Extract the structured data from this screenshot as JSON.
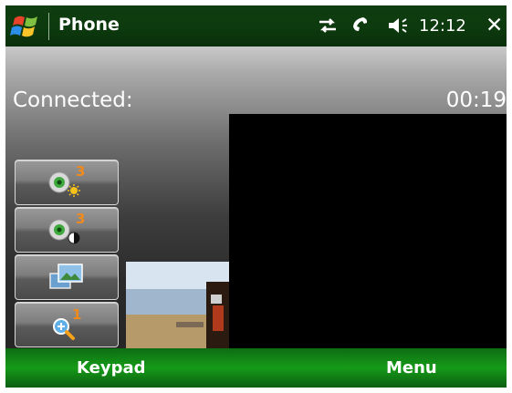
{
  "titlebar": {
    "app_title": "Phone",
    "clock": "12:12",
    "close_label": "✕",
    "status_icons": [
      "data-connection-icon",
      "phone-signal-icon",
      "speaker-volume-icon"
    ]
  },
  "call": {
    "status_label": "Connected:",
    "timer": "00:19"
  },
  "controls": {
    "brightness_badge": "3",
    "contrast_badge": "3",
    "zoom_badge": "1"
  },
  "softkeys": {
    "left": "Keypad",
    "right": "Menu"
  },
  "colors": {
    "titlebar_bg": "#0d3a0e",
    "softkey_bg": "#169a19",
    "remote_video_bg": "#000000",
    "badge_orange": "#f08a1c"
  }
}
